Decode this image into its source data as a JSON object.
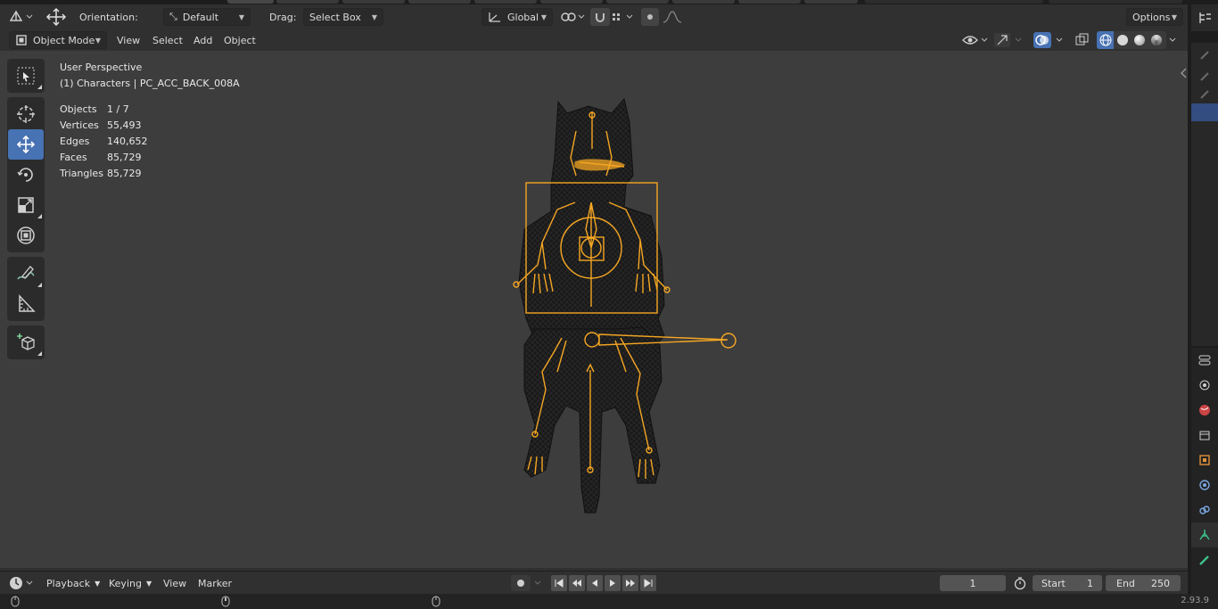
{
  "header": {
    "orientation_label": "Orientation:",
    "orientation_value": "Default",
    "drag_label": "Drag:",
    "drag_value": "Select Box",
    "transform_space": "Global",
    "options_label": "Options"
  },
  "viewport_header": {
    "mode": "Object Mode",
    "menus": [
      "View",
      "Select",
      "Add",
      "Object"
    ]
  },
  "overlay": {
    "perspective": "User Perspective",
    "object_info": "(1) Characters | PC_ACC_BACK_008A",
    "stats": [
      {
        "label": "Objects",
        "value": "1 / 7"
      },
      {
        "label": "Vertices",
        "value": "55,493"
      },
      {
        "label": "Edges",
        "value": "140,652"
      },
      {
        "label": "Faces",
        "value": "85,729"
      },
      {
        "label": "Triangles",
        "value": "85,729"
      }
    ]
  },
  "toolbar": {
    "tools": [
      "select-box",
      "cursor",
      "move",
      "rotate",
      "scale",
      "transform",
      "annotate",
      "measure",
      "add-cube"
    ],
    "active": "move"
  },
  "timeline": {
    "menus": [
      "Playback",
      "Keying",
      "View",
      "Marker"
    ],
    "current_frame": "1",
    "start_label": "Start",
    "start_value": "1",
    "end_label": "End",
    "end_value": "250"
  },
  "statusbar": {
    "version": "2.93.9"
  },
  "colors": {
    "accent": "#4772b3",
    "armature": "#f5a623",
    "viewport_bg": "#3d3d3d",
    "header_bg": "#303030"
  }
}
